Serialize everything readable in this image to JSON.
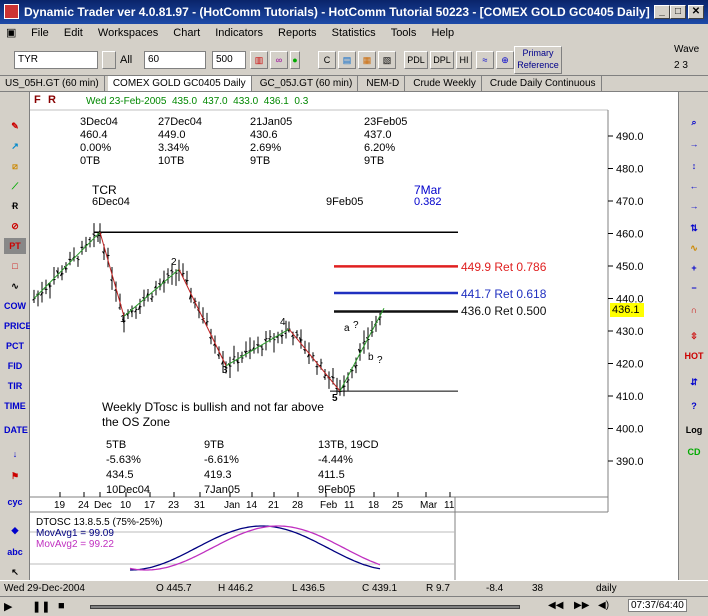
{
  "window": {
    "title": "Dynamic Trader ver 4.0.81.97 - (HotComm Tutorials) - HotComm Tutorial 50223 - [COMEX GOLD GC0405 Daily]"
  },
  "menu": [
    "File",
    "Edit",
    "Workspaces",
    "Chart",
    "Indicators",
    "Reports",
    "Statistics",
    "Tools",
    "Help"
  ],
  "toolbar": {
    "symbol": "TYR",
    "all_label": "All",
    "period": "60",
    "bars": "500",
    "pdl": "PDL",
    "dpl": "DPL",
    "hi": "HI",
    "primary_ref": "Primary Reference",
    "wave": "Wave",
    "wave_nums": "2  3"
  },
  "tabs": [
    "US_05H.GT (60 min)",
    "COMEX GOLD GC0405 Daily",
    "GC_05J.GT (60 min)",
    "NEM-D",
    "Crude Weekly",
    "Crude Daily Continuous"
  ],
  "chart": {
    "header": {
      "date": "Wed 23-Feb-2005",
      "open": "435.0",
      "high": "437.0",
      "low": "433.0",
      "close": "436.1",
      "change": "0.3"
    },
    "top_annotations": [
      {
        "date": "3Dec04",
        "price": "460.4",
        "pct": "0.00%",
        "tb": "0TB"
      },
      {
        "date": "27Dec04",
        "price": "449.0",
        "pct": "3.34%",
        "tb": "10TB"
      },
      {
        "date": "21Jan05",
        "price": "430.6",
        "pct": "2.69%",
        "tb": "9TB"
      },
      {
        "date": "23Feb05",
        "price": "437.0",
        "pct": "6.20%",
        "tb": "9TB"
      }
    ],
    "tcr": {
      "label": "TCR",
      "date": "6Dec04",
      "date2": "9Feb05",
      "date3": "7Mar",
      "ratio": "0.382"
    },
    "ret_lines": [
      {
        "label": "449.9 Ret 0.786",
        "price": 449.9,
        "color": "#e02020"
      },
      {
        "label": "441.7 Ret 0.618",
        "price": 441.7,
        "color": "#2030c0"
      },
      {
        "label": "436.0 Ret 0.500",
        "price": 436.0,
        "color": "#101010"
      }
    ],
    "price_axis": [
      "490.0",
      "480.0",
      "470.0",
      "460.0",
      "450.0",
      "440.0",
      "430.0",
      "420.0",
      "410.0",
      "400.0",
      "390.0"
    ],
    "current_price": "436.1",
    "wave_labels": [
      "1",
      "2",
      "3",
      "4",
      "5",
      "a",
      "?",
      "b",
      "?"
    ],
    "comment": "Weekly DTosc is bullish and not far above the OS Zone",
    "bottom_annotations": [
      {
        "tb": "5TB",
        "pct": "-5.63%",
        "price": "434.5",
        "date": "10Dec04"
      },
      {
        "tb": "9TB",
        "pct": "-6.61%",
        "price": "419.3",
        "date": "7Jan05"
      },
      {
        "tb": "13TB, 19CD",
        "pct": "-4.44%",
        "price": "411.5",
        "date": "9Feb05"
      }
    ],
    "x_axis": [
      "19",
      "24",
      "Dec",
      "10",
      "17",
      "23",
      "31",
      "Jan",
      "14",
      "21",
      "28",
      "Feb",
      "11",
      "18",
      "25",
      "Mar",
      "11"
    ],
    "osc": {
      "title": "DTOSC 13.8.5.5 (75%-25%)",
      "ma1": "MovAvg1 = 99.09",
      "ma2": "MovAvg2 = 99.22"
    }
  },
  "status": {
    "date": "Wed 29-Dec-2004",
    "o": "O 445.7",
    "h": "H 446.2",
    "l": "L 436.5",
    "c": "C 439.1",
    "r": "R 9.7",
    "v1": "-8.4",
    "v2": "38",
    "tf": "daily"
  },
  "bottom": {
    "time": "07:37/64:40"
  },
  "colors": {
    "title_bg": "#0a246a",
    "up": "#2a9a2a",
    "down": "#c02020",
    "osc1": "#000080",
    "osc2": "#c030c0"
  }
}
